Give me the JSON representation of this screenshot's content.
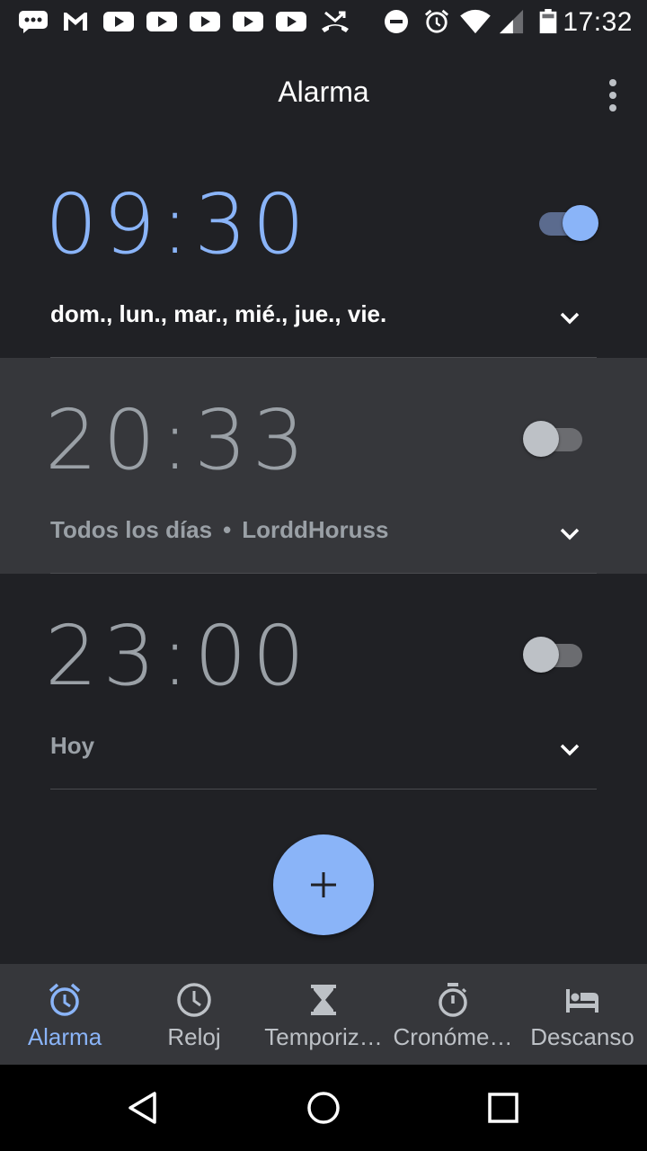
{
  "status_bar": {
    "time": "17:32",
    "left_icons": [
      "messages-icon",
      "gmail-icon",
      "youtube-icon",
      "youtube-icon",
      "youtube-icon",
      "youtube-icon",
      "youtube-icon",
      "missed-call-icon"
    ],
    "right_icons": [
      "do-not-disturb-icon",
      "alarm-icon",
      "wifi-icon",
      "signal-icon",
      "battery-icon"
    ]
  },
  "app_bar": {
    "title": "Alarma",
    "overflow_icon": "more-vert-icon"
  },
  "alarms": [
    {
      "time": "09:30",
      "enabled": true,
      "days": "dom., lun., mar., mié., jue., vie.",
      "label": ""
    },
    {
      "time": "20:33",
      "enabled": false,
      "days": "Todos los días",
      "separator": "•",
      "label": "LorddHoruss"
    },
    {
      "time": "23:00",
      "enabled": false,
      "days": "Hoy",
      "label": ""
    }
  ],
  "fab": {
    "icon": "add-icon"
  },
  "bottom_nav": [
    {
      "label": "Alarma",
      "icon": "alarm-icon",
      "active": true
    },
    {
      "label": "Reloj",
      "icon": "clock-icon",
      "active": false
    },
    {
      "label": "Temporiz…",
      "icon": "hourglass-icon",
      "active": false
    },
    {
      "label": "Cronóme…",
      "icon": "stopwatch-icon",
      "active": false
    },
    {
      "label": "Descanso",
      "icon": "bed-icon",
      "active": false
    }
  ],
  "system_nav": [
    "back-icon",
    "home-icon",
    "recents-icon"
  ],
  "colors": {
    "background": "#202125",
    "accent": "#8ab4f8",
    "card_highlight": "#36373b",
    "inactive_text": "#9aa0a6"
  }
}
